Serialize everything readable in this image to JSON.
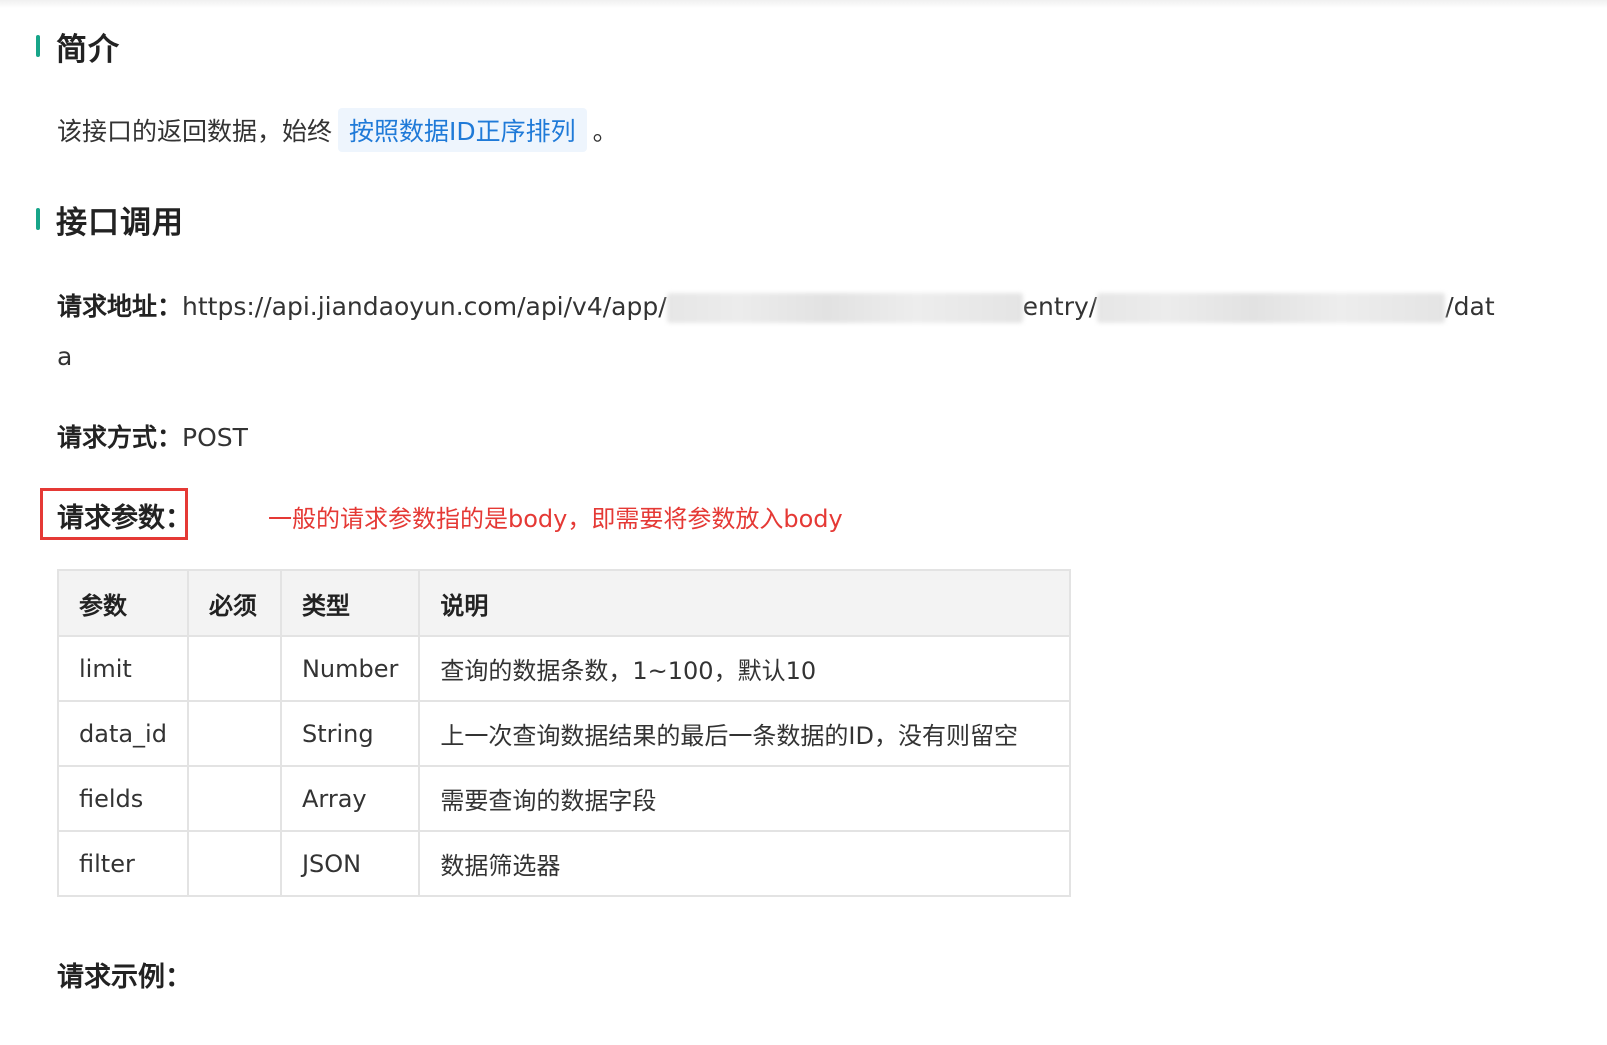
{
  "sections": {
    "intro_heading": "简介",
    "api_heading": "接口调用"
  },
  "intro": {
    "text_before": "该接口的返回数据，始终",
    "highlight": "按照数据ID正序排列",
    "text_after": "。"
  },
  "request": {
    "url_label": "请求地址：",
    "url_part1": "https://api.jiandaoyun.com/api/v4/app/",
    "url_part2": "entry/",
    "url_part3": "/dat",
    "url_wrap": "a",
    "method_label": "请求方式：",
    "method_value": "POST",
    "params_label": "请求参数：",
    "params_annotation": "一般的请求参数指的是body，即需要将参数放入body",
    "example_label": "请求示例："
  },
  "table": {
    "headers": [
      "参数",
      "必须",
      "类型",
      "说明"
    ],
    "rows": [
      {
        "param": "limit",
        "required": "",
        "type": "Number",
        "desc": "查询的数据条数，1~100，默认10"
      },
      {
        "param": "data_id",
        "required": "",
        "type": "String",
        "desc": "上一次查询数据结果的最后一条数据的ID，没有则留空"
      },
      {
        "param": "fields",
        "required": "",
        "type": "Array",
        "desc": "需要查询的数据字段"
      },
      {
        "param": "filter",
        "required": "",
        "type": "JSON",
        "desc": "数据筛选器"
      }
    ]
  },
  "colors": {
    "accent": "#17a589",
    "highlight_bg": "#eef5fd",
    "highlight_text": "#1f7ad8",
    "annotation_red": "#e53935"
  }
}
